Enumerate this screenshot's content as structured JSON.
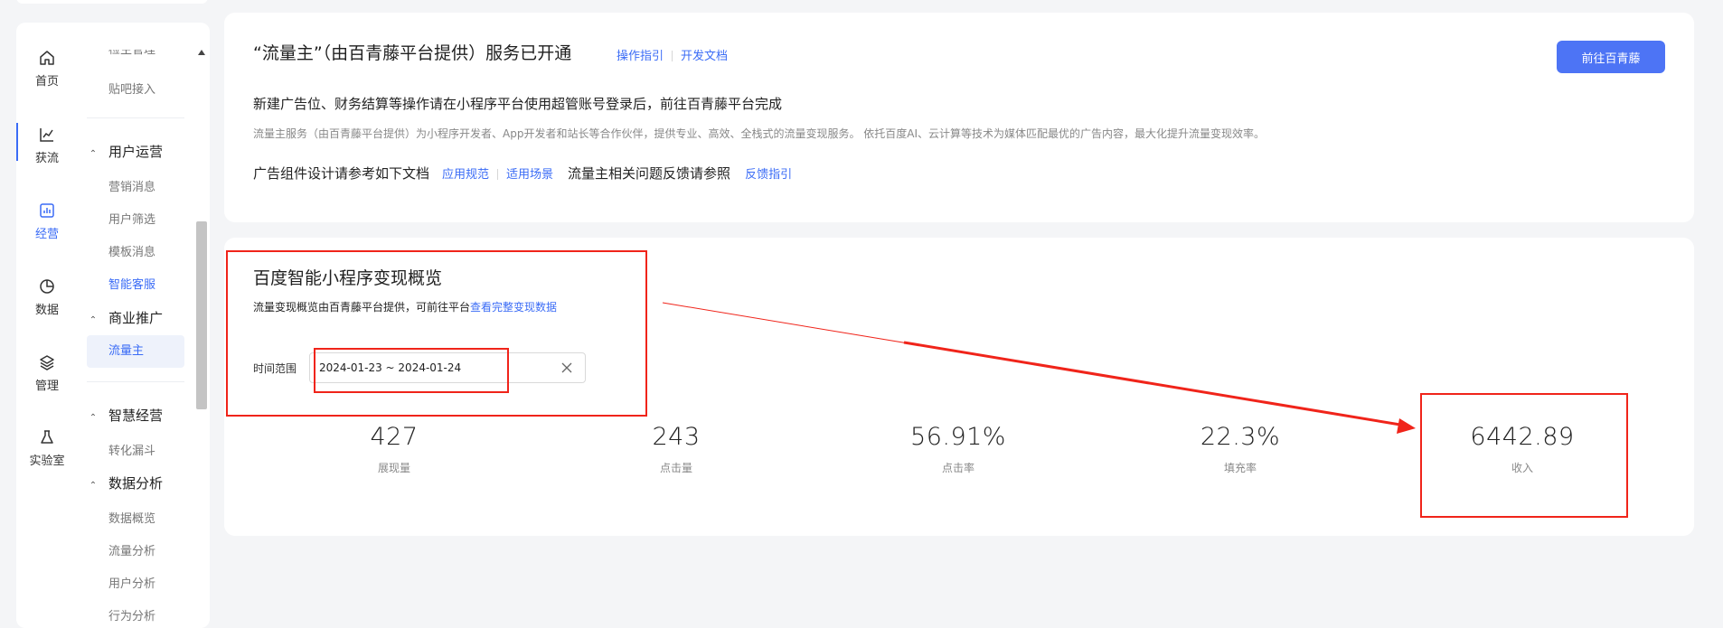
{
  "rail": {
    "items": [
      {
        "label": "首页",
        "icon": "home-icon"
      },
      {
        "label": "获流",
        "icon": "line-chart-icon"
      },
      {
        "label": "经营",
        "icon": "bar-chart-icon"
      },
      {
        "label": "数据",
        "icon": "pie-chart-icon"
      },
      {
        "label": "管理",
        "icon": "layers-icon"
      },
      {
        "label": "实验室",
        "icon": "flask-icon"
      }
    ]
  },
  "menu": {
    "cut_top": "检主管理",
    "tieba": "贴吧接入",
    "group_user_ops": "用户运营",
    "marketing_msg": "营销消息",
    "user_filter": "用户筛选",
    "template_msg": "模板消息",
    "smart_cs": "智能客服",
    "group_biz": "商业推广",
    "traffic_owner": "流量主",
    "group_smart": "智慧经营",
    "funnel": "转化漏斗",
    "group_analytics": "数据分析",
    "data_overview": "数据概览",
    "traffic_analysis": "流量分析",
    "user_analysis": "用户分析",
    "behavior_analysis": "行为分析"
  },
  "card1": {
    "title": "“流量主”（由百青藤平台提供）服务已开通",
    "link_guide": "操作指引",
    "link_dev": "开发文档",
    "button": "前往百青藤",
    "heading": "新建广告位、财务结算等操作请在小程序平台使用超管账号登录后，前往百青藤平台完成",
    "desc": "流量主服务（由百青藤平台提供）为小程序开发者、App开发者和站长等合作伙伴，提供专业、高效、全栈式的流量变现服务。 依托百度AI、云计算等技术为媒体匹配最优的广告内容，最大化提升流量变现效率。",
    "row_text1": "广告组件设计请参考如下文档",
    "link_spec": "应用规范",
    "link_scene": "适用场景",
    "row_text2": "流量主相关问题反馈请参照",
    "link_feedback": "反馈指引"
  },
  "card2": {
    "title": "百度智能小程序变现概览",
    "subtitle": "流量变现概览由百青藤平台提供，可前往平台",
    "subtitle_link": "查看完整变现数据",
    "date_label": "时间范围",
    "date_value": "2024-01-23 ~ 2024-01-24",
    "metrics": [
      {
        "value": "427",
        "label": "展现量"
      },
      {
        "value": "243",
        "label": "点击量"
      },
      {
        "value": "56.91%",
        "label": "点击率"
      },
      {
        "value": "22.3%",
        "label": "填充率"
      },
      {
        "value": "6442.89",
        "label": "收入"
      }
    ]
  },
  "colors": {
    "accent": "#3b6cf6",
    "button": "#4d74f5",
    "annotation": "#f0241a"
  }
}
